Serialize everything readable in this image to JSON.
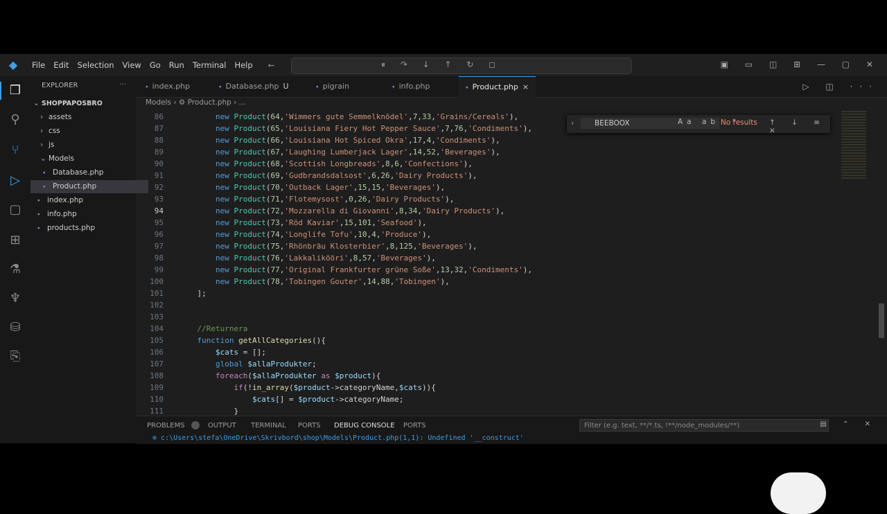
{
  "menu": [
    "File",
    "Edit",
    "Selection",
    "View",
    "Go",
    "Run",
    "Terminal",
    "Help"
  ],
  "sidebar": {
    "title": "EXPLORER",
    "root": "SHOPPAPOSBRO",
    "items": [
      {
        "label": "assets",
        "type": "folder",
        "depth": 1
      },
      {
        "label": "css",
        "type": "folder",
        "depth": 1
      },
      {
        "label": "js",
        "type": "folder",
        "depth": 1
      },
      {
        "label": "Models",
        "type": "folder-open",
        "depth": 1
      },
      {
        "label": "Database.php",
        "type": "php",
        "depth": 2
      },
      {
        "label": "Product.php",
        "type": "php",
        "depth": 2,
        "selected": true
      },
      {
        "label": "index.php",
        "type": "php",
        "depth": 1
      },
      {
        "label": "info.php",
        "type": "php",
        "depth": 1
      },
      {
        "label": "products.php",
        "type": "php",
        "depth": 1
      }
    ]
  },
  "tabs": [
    {
      "label": "index.php",
      "active": false,
      "modified": ""
    },
    {
      "label": "Database.php",
      "active": false,
      "modified": "U"
    },
    {
      "label": "pigrain",
      "active": false,
      "modified": ""
    },
    {
      "label": "info.php",
      "active": false,
      "modified": ""
    },
    {
      "label": "Product.php",
      "active": true,
      "modified": "×"
    }
  ],
  "breadcrumb": "Models › ⚙ Product.php › ...",
  "find": {
    "query": "BEEBOOX",
    "result": "No results"
  },
  "code": [
    {
      "n": "86",
      "text": "        new Product(64,'Wimmers gute Semmelknödel',7,33,'Grains/Cereals'),"
    },
    {
      "n": "87",
      "text": "        new Product(65,'Louisiana Fiery Hot Pepper Sauce',7,76,'Condiments'),"
    },
    {
      "n": "88",
      "text": "        new Product(66,'Louisiana Hot Spiced Okra',17,4,'Condiments'),"
    },
    {
      "n": "89",
      "text": "        new Product(67,'Laughing Lumberjack Lager',14,52,'Beverages'),"
    },
    {
      "n": "90",
      "text": "        new Product(68,'Scottish Longbreads',8,6,'Confections'),"
    },
    {
      "n": "91",
      "text": "        new Product(69,'Gudbrandsdalsost',6,26,'Dairy Products'),"
    },
    {
      "n": "92",
      "text": "        new Product(70,'Outback Lager',15,15,'Beverages'),"
    },
    {
      "n": "93",
      "text": "        new Product(71,'Flotemysost',0,26,'Dairy Products'),"
    },
    {
      "n": "94",
      "text": "        new Product(72,'Mozzarella di Giovanni',8,34,'Dairy Products'),"
    },
    {
      "n": "95",
      "text": "        new Product(73,'Röd Kaviar',15,101,'Seafood'),"
    },
    {
      "n": "96",
      "text": "        new Product(74,'Longlife Tofu',10,4,'Produce'),"
    },
    {
      "n": "97",
      "text": "        new Product(75,'Rhönbräu Klosterbier',8,125,'Beverages'),"
    },
    {
      "n": "98",
      "text": "        new Product(76,'Lakkalikööri',8,57,'Beverages'),"
    },
    {
      "n": "99",
      "text": "        new Product(77,'Original Frankfurter grüne Soße',13,32,'Condiments'),"
    },
    {
      "n": "100",
      "text": "        new Product(78,'Tobingen Gouter',14,88,'Tobingen'),"
    },
    {
      "n": "101",
      "text": "    ];"
    },
    {
      "n": "102",
      "text": ""
    },
    {
      "n": "103",
      "text": ""
    },
    {
      "n": "104",
      "text": "    //Returnera"
    },
    {
      "n": "105",
      "text": "    function getAllCategories(){"
    },
    {
      "n": "106",
      "text": "        $cats = [];"
    },
    {
      "n": "107",
      "text": "        global $allaProdukter;"
    },
    {
      "n": "108",
      "text": "        foreach($allaProdukter as $product){"
    },
    {
      "n": "109",
      "text": "            if(!in_array($product->categoryName,$cats)){"
    },
    {
      "n": "110",
      "text": "                $cats[] = $product->categoryName;"
    },
    {
      "n": "111",
      "text": "            }"
    }
  ],
  "panel": {
    "tabs": [
      "PROBLEMS",
      "OUTPUT",
      "TERMINAL",
      "PORTS",
      "DEBUG CONSOLE",
      "PORTS"
    ],
    "filter_placeholder": "Filter (e.g. text, **/*.ts, !**/node_modules/**)",
    "problem_line": "⊗ c:\\Users\\stefa\\OneDrive\\Skrivbord\\shop\\Models\\Product.php(1,1): Undefined '__construct'"
  }
}
